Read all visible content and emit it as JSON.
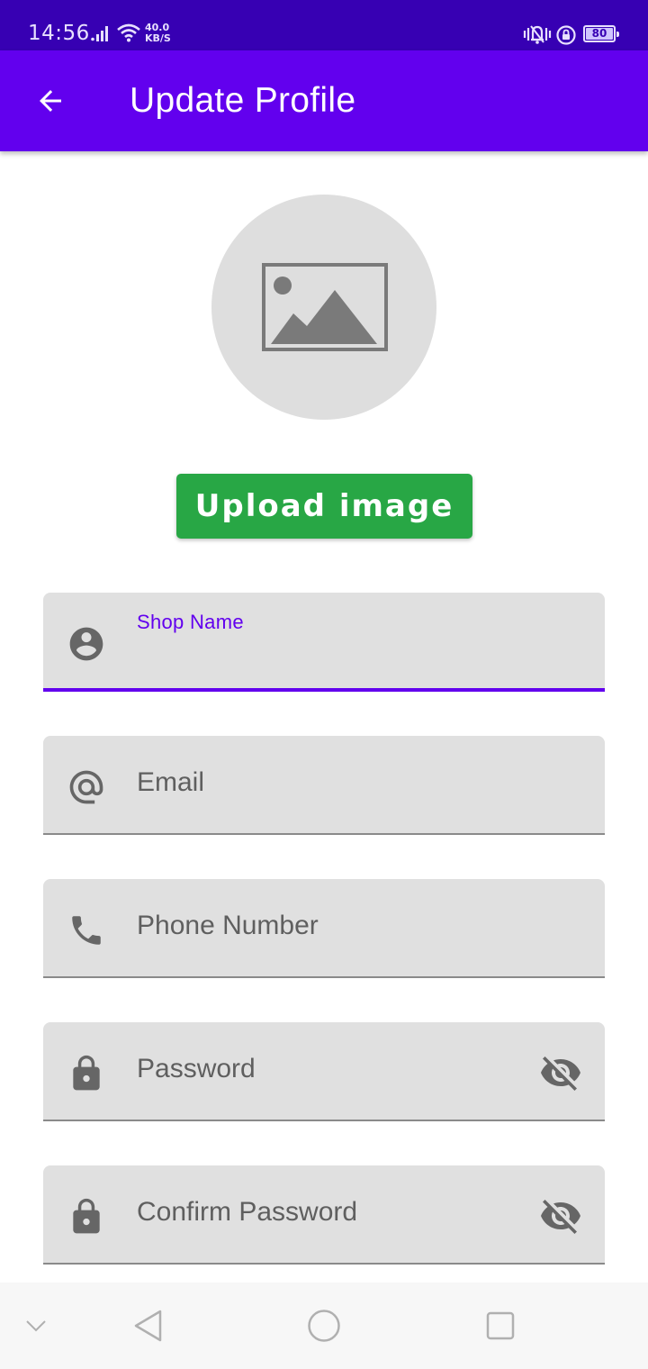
{
  "status_bar": {
    "time": "14:56",
    "speed_value": "40.0",
    "speed_unit": "KB/S",
    "battery": "80",
    "icons": [
      "signal-icon",
      "wifi-icon",
      "vibrate-icon",
      "rotation-lock-icon",
      "battery-icon"
    ]
  },
  "app_bar": {
    "title": "Update Profile",
    "back_icon": "arrow-back-icon",
    "background": "#6200ee"
  },
  "profile_image": {
    "placeholder_icon": "image-placeholder-icon"
  },
  "upload_button": {
    "label": "Upload image",
    "color": "#28a745"
  },
  "fields": [
    {
      "label": "Shop Name",
      "icon": "account-circle-icon",
      "focused": true
    },
    {
      "label": "Email",
      "icon": "at-sign-icon"
    },
    {
      "label": "Phone Number",
      "icon": "phone-icon"
    },
    {
      "label": "Password",
      "icon": "lock-icon",
      "trailing_icon": "visibility-off-icon"
    },
    {
      "label": "Confirm Password",
      "icon": "lock-icon",
      "trailing_icon": "visibility-off-icon"
    }
  ],
  "nav_bar": {
    "items": [
      "chevron-down-icon",
      "back-triangle-icon",
      "home-circle-icon",
      "recents-square-icon"
    ]
  },
  "colors": {
    "primary": "#6200ee",
    "status_bar": "#3700b3",
    "field_background": "#e0e0e0"
  }
}
